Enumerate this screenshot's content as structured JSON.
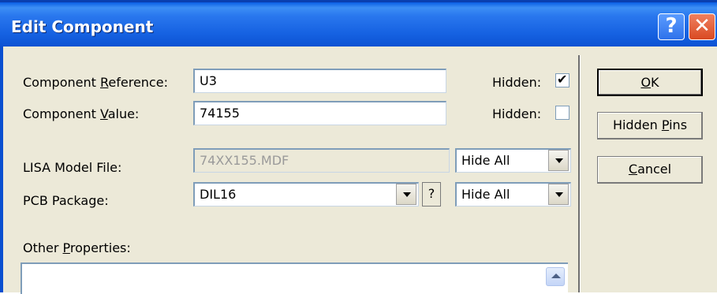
{
  "window": {
    "title": "Edit Component"
  },
  "titlebar": {
    "help_glyph": "?",
    "close_glyph": "✕"
  },
  "fields": {
    "component_reference": {
      "label_pre": "Component ",
      "label_acc": "R",
      "label_post": "eference:",
      "value": "U3",
      "hidden_label": "Hidden:",
      "hidden_checked": true
    },
    "component_value": {
      "label_pre": "Component ",
      "label_acc": "V",
      "label_post": "alue:",
      "value": "74155",
      "hidden_label": "Hidden:",
      "hidden_checked": false
    },
    "lisa_model_file": {
      "label": "LISA Model File:",
      "value": "74XX155.MDF",
      "visibility": "Hide All"
    },
    "pcb_package": {
      "label": "PCB Package:",
      "value": "DIL16",
      "help": "?",
      "visibility": "Hide All"
    },
    "other_properties": {
      "label_pre": "Other ",
      "label_acc": "P",
      "label_post": "roperties:"
    }
  },
  "buttons": {
    "ok": {
      "acc": "O",
      "rest": "K"
    },
    "hidden_pins": {
      "pre": "Hidden ",
      "acc": "P",
      "rest": "ins"
    },
    "cancel": {
      "acc": "C",
      "rest": "ancel"
    }
  },
  "check_glyph": "✔",
  "colors": {
    "titlebar": "#0a5ee5",
    "dialog_bg": "#ece9d8",
    "close_button": "#d94a22"
  }
}
